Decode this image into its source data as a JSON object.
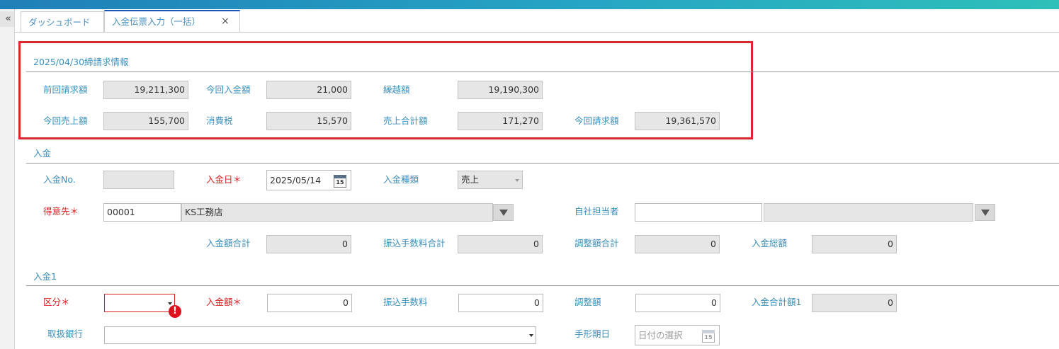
{
  "collapse_icon": "«",
  "tabs": [
    {
      "label": "ダッシュボード"
    },
    {
      "label": "入金伝票入力（一括）",
      "close": "×"
    }
  ],
  "billing": {
    "title": "2025/04/30締請求情報",
    "prev_invoice_label": "前回請求額",
    "prev_invoice_value": "19,211,300",
    "current_payment_label": "今回入金額",
    "current_payment_value": "21,000",
    "carryover_label": "繰越額",
    "carryover_value": "19,190,300",
    "current_sales_label": "今回売上額",
    "current_sales_value": "155,700",
    "tax_label": "消費税",
    "tax_value": "15,570",
    "sales_total_label": "売上合計額",
    "sales_total_value": "171,270",
    "current_invoice_label": "今回請求額",
    "current_invoice_value": "19,361,570"
  },
  "payment": {
    "title": "入金",
    "no_label": "入金No.",
    "no_value": "",
    "date_label": "入金日",
    "date_value": "2025/05/14",
    "date_icon_text": "15",
    "type_label": "入金種類",
    "type_value": "売上",
    "customer_label": "得意先",
    "customer_code": "00001",
    "customer_name": "KS工務店",
    "staff_label": "自社担当者",
    "staff_code": "",
    "staff_name": "",
    "amount_total_label": "入金額合計",
    "amount_total_value": "0",
    "fee_total_label": "振込手数料合計",
    "fee_total_value": "0",
    "adjust_total_label": "調整額合計",
    "adjust_total_value": "0",
    "grand_total_label": "入金総額",
    "grand_total_value": "0",
    "required_mark": "＊"
  },
  "payment1": {
    "title": "入金1",
    "category_label": "区分",
    "category_value": "",
    "error_mark": "!",
    "amount_label": "入金額",
    "amount_value": "0",
    "fee_label": "振込手数料",
    "fee_value": "0",
    "adjust_label": "調整額",
    "adjust_value": "0",
    "total_label": "入金合計額1",
    "total_value": "0",
    "bank_label": "取扱銀行",
    "bank_value": "",
    "note_date_label": "手形期日",
    "note_date_placeholder": "日付の選択",
    "note_icon_text": "15"
  },
  "colors": {
    "accent": "#3b8fbd",
    "required": "#d62020",
    "highlight": "#d9282e",
    "tab_active": "#1a56b8"
  }
}
